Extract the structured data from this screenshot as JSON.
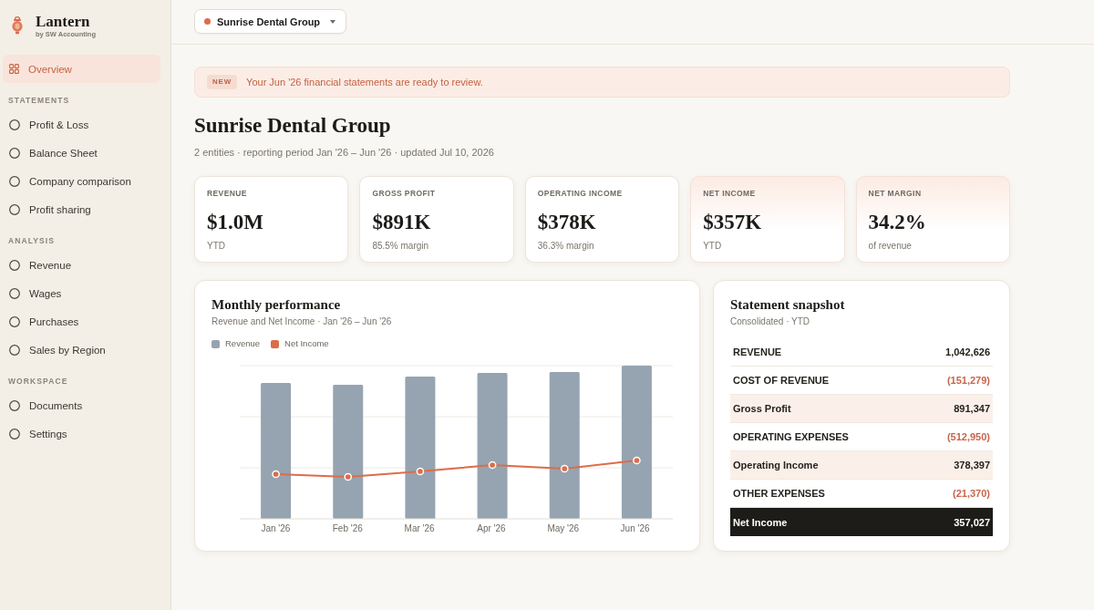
{
  "sidebar": {
    "brand": {
      "name": "Lantern",
      "tagline": "by SW Accounting"
    },
    "items": [
      {
        "label": "Overview",
        "selected": true
      }
    ],
    "sections": [
      {
        "label": "STATEMENTS",
        "items": [
          {
            "label": "Profit & Loss",
            "selected": false
          },
          {
            "label": "Balance Sheet",
            "selected": false
          },
          {
            "label": "Company comparison",
            "selected": false
          },
          {
            "label": "Profit sharing",
            "selected": false
          }
        ]
      },
      {
        "label": "ANALYSIS",
        "items": [
          {
            "label": "Revenue",
            "selected": false
          },
          {
            "label": "Wages",
            "selected": false
          },
          {
            "label": "Purchases",
            "selected": false
          },
          {
            "label": "Sales by Region",
            "selected": false
          }
        ]
      },
      {
        "label": "WORKSPACE",
        "items": [
          {
            "label": "Documents",
            "selected": false
          },
          {
            "label": "Settings",
            "selected": false
          }
        ]
      }
    ]
  },
  "topbar": {
    "company_picker": {
      "label": "Sunrise Dental Group"
    }
  },
  "banner": {
    "badge": "NEW",
    "message": "Your Jun '26 financial statements are ready to review."
  },
  "page": {
    "title": "Sunrise Dental Group",
    "subtitle": "2 entities · reporting period Jan '26 – Jun '26 · updated Jul 10, 2026"
  },
  "kpis": [
    {
      "label": "REVENUE",
      "value": "$1.0M",
      "note": "YTD",
      "highlighted": false
    },
    {
      "label": "GROSS PROFIT",
      "value": "$891K",
      "note": "85.5% margin",
      "highlighted": false
    },
    {
      "label": "OPERATING INCOME",
      "value": "$378K",
      "note": "36.3% margin",
      "highlighted": false
    },
    {
      "label": "NET INCOME",
      "value": "$357K",
      "note": "YTD",
      "highlighted": true
    },
    {
      "label": "NET MARGIN",
      "value": "34.2%",
      "note": "of revenue",
      "highlighted": true
    }
  ],
  "chart_card": {
    "title": "Monthly performance",
    "subtitle": "Revenue and Net Income · Jan '26 – Jun '26",
    "legend": [
      {
        "label": "Revenue",
        "color": "#95a4b0"
      },
      {
        "label": "Net Income",
        "color": "#dc6d4b"
      }
    ],
    "x_labels": [
      "Jan '26",
      "Feb '26",
      "Mar '26",
      "Apr '26",
      "May '26",
      "Jun '26"
    ]
  },
  "snapshot": {
    "title": "Statement snapshot",
    "subtitle": "Consolidated · YTD",
    "rows": [
      {
        "kind": "line",
        "label": "REVENUE",
        "value": "1,042,626",
        "negative": false
      },
      {
        "kind": "line",
        "label": "COST OF REVENUE",
        "value": "(151,279)",
        "negative": true
      },
      {
        "kind": "subtotal",
        "label": "Gross Profit",
        "value": "891,347",
        "negative": false
      },
      {
        "kind": "line",
        "label": "OPERATING EXPENSES",
        "value": "(512,950)",
        "negative": true
      },
      {
        "kind": "subtotal",
        "label": "Operating Income",
        "value": "378,397",
        "negative": false
      },
      {
        "kind": "line",
        "label": "OTHER EXPENSES",
        "value": "(21,370)",
        "negative": true
      },
      {
        "kind": "total",
        "label": "Net Income",
        "value": "357,027",
        "negative": false
      }
    ]
  }
}
